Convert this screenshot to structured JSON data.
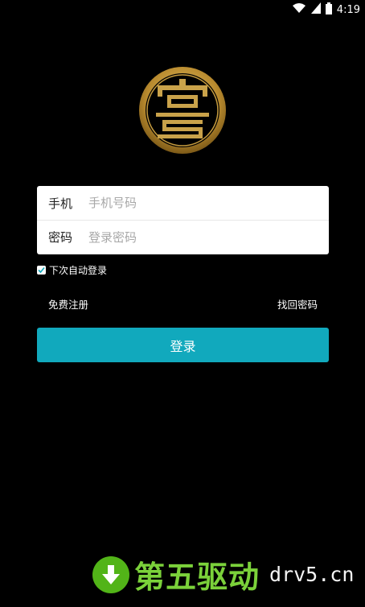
{
  "status_bar": {
    "time": "4:19",
    "icons": [
      "wifi-icon",
      "signal-icon",
      "battery-icon"
    ]
  },
  "logo": {
    "icon": "gold-seal-logo",
    "colors": {
      "ring": "#c9a24a",
      "core": "#000000"
    }
  },
  "form": {
    "phone_label": "手机",
    "phone_placeholder": "手机号码",
    "password_label": "密码",
    "password_placeholder": "登录密码"
  },
  "remember": {
    "label": "下次自动登录",
    "checked": true
  },
  "links": {
    "register": "免费注册",
    "forgot": "找回密码"
  },
  "login_button": {
    "label": "登录",
    "color": "#11a9bd"
  },
  "watermark": {
    "icon": "download-arrow-icon",
    "text": "第五驱动",
    "domain": "drv5.cn",
    "color": "#7bd13a"
  }
}
